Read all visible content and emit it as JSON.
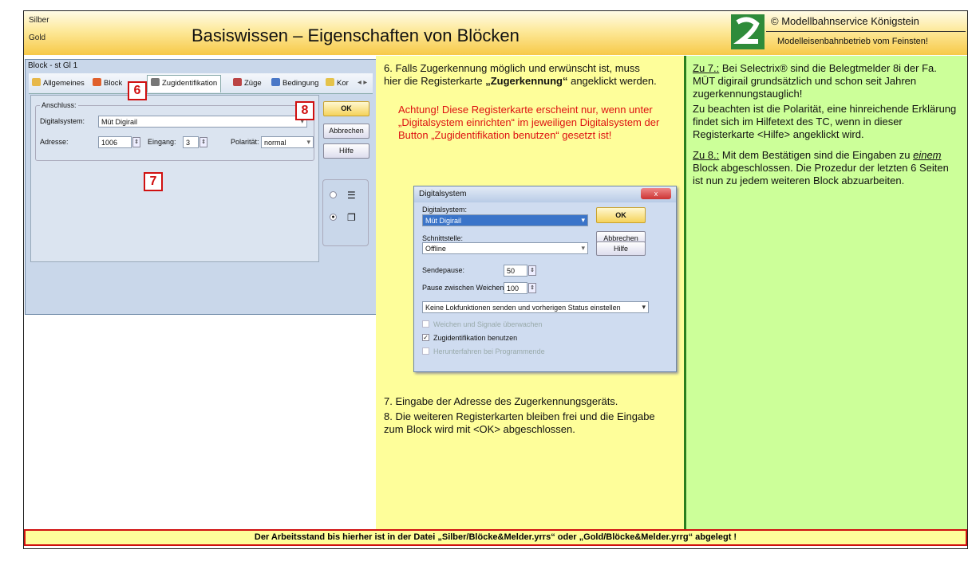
{
  "header": {
    "level_silber": "Silber",
    "level_gold": "Gold",
    "title": "Basiswissen – Eigenschaften von Blöcken",
    "copyright": "© Modellbahnservice Königstein",
    "slogan": "Modelleisenbahnbetrieb vom Feinsten!"
  },
  "block_window": {
    "title": "Block - st Gl 1",
    "tabs": [
      "Allgemeines",
      "Block",
      "Zugidentifikation",
      "Züge",
      "Bedingung",
      "Kor"
    ],
    "tab_arrow": "◂ ▸",
    "group": "Anschluss:",
    "digitalsystem_label": "Digitalsystem:",
    "digitalsystem_value": "Müt Digirail",
    "adresse_label": "Adresse:",
    "adresse_value": "1006",
    "eingang_label": "Eingang:",
    "eingang_value": "3",
    "polaritaet_label": "Polarität:",
    "polaritaet_value": "normal",
    "ok": "OK",
    "abbrechen": "Abbrechen",
    "hilfe": "Hilfe"
  },
  "markers": {
    "m6": "6",
    "m7": "7",
    "m8": "8"
  },
  "mid": {
    "item6": "6. Falls Zugerkennung möglich und erwünscht ist, muss hier die Registerkarte",
    "item6_bold": "„Zugerkennung“",
    "item6_end": "angeklickt werden.",
    "warning": "Achtung! Diese Registerkarte erscheint nur, wenn unter „Digitalsystem einrichten“ im jeweiligen Digitalsystem der Button „Zugidentifikation benutzen“ gesetzt ist!",
    "item7": "7. Eingabe der Adresse des Zugerkennungsgeräts.",
    "item8": "8. Die weiteren Registerkarten bleiben frei und die Eingabe zum Block wird mit <OK> abgeschlossen."
  },
  "dialog": {
    "title": "Digitalsystem",
    "close": "x",
    "digitalsystem_label": "Digitalsystem:",
    "digitalsystem_value": "Müt Digirail",
    "schnittstelle_label": "Schnittstelle:",
    "schnittstelle_value": "Offline",
    "ok": "OK",
    "abbrechen": "Abbrechen",
    "hilfe": "Hilfe",
    "sendepause_label": "Sendepause:",
    "sendepause_value": "50",
    "pause_label": "Pause zwischen Weichen:",
    "pause_value": "100",
    "lok_option": "Keine Lokfunktionen senden und vorherigen Status einstellen",
    "cb1": "Weichen und Signale überwachen",
    "cb2": "Zugidentifikation benutzen",
    "cb3": "Herunterfahren bei Programmende"
  },
  "right": {
    "zu7_label": "Zu 7.:",
    "zu7_text": "Bei Selectrix® sind die Belegtmelder 8i der Fa. MÜT digirail grundsätzlich und schon seit Jahren zugerkennungstauglich!",
    "zu7_text2": "Zu beachten ist die Polarität, eine hinreichende Erklärung findet sich im Hilfetext des TC, wenn in dieser Registerkarte <Hilfe> angeklickt wird.",
    "zu8_label": "Zu 8.:",
    "zu8_em": "einem",
    "zu8_text_a": "Mit dem Bestätigen sind die Eingaben zu",
    "zu8_text_b": "Block abgeschlossen. Die Prozedur der letzten 6 Seiten ist nun zu jedem weiteren Block abzuarbeiten."
  },
  "footer": "Der Arbeitsstand bis hierher ist in der Datei „Silber/Blöcke&Melder.yrrs“ oder „Gold/Blöcke&Melder.yrrg“ abgelegt !"
}
